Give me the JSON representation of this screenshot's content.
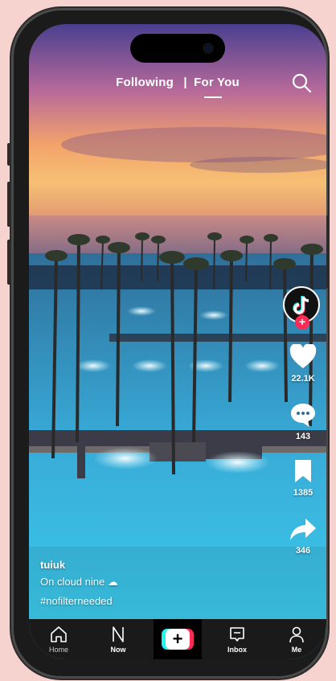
{
  "top_tabs": {
    "following": "Following",
    "separator": "|",
    "for_you": "For You"
  },
  "profile": {
    "follow_plus": "+"
  },
  "actions": {
    "likes": "22.1K",
    "comments": "143",
    "saves": "1385",
    "shares": "346"
  },
  "caption": {
    "username": "tuiuk",
    "text": "On cloud nine ☁",
    "hashtag": "#nofilterneeded"
  },
  "nav": {
    "home": "Home",
    "now": "Now",
    "create": "+",
    "inbox": "Inbox",
    "me": "Me"
  },
  "colors": {
    "accent_red": "#fe2c55",
    "accent_cyan": "#25f4ee",
    "nav_bg": "#1a1a1a"
  }
}
